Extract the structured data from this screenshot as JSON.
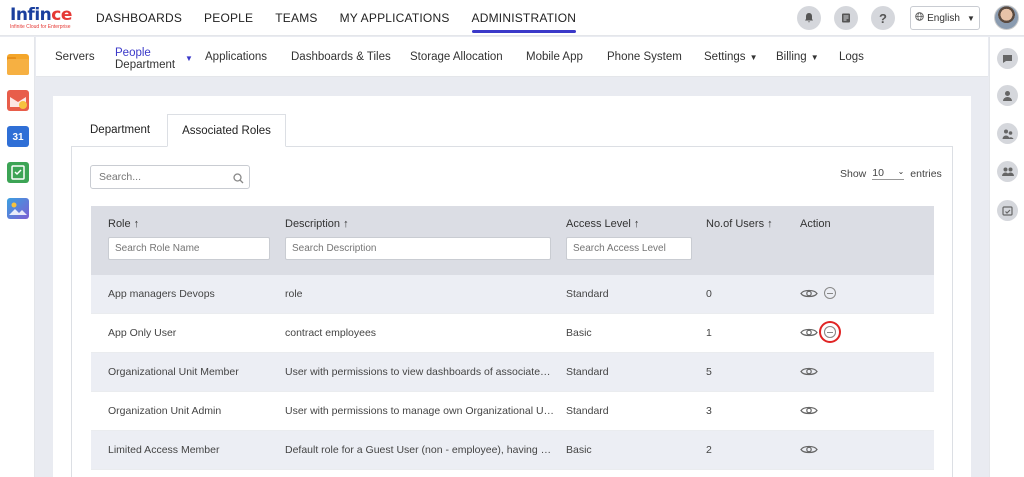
{
  "brand": {
    "name_part1": "Infin",
    "name_accent": "ce",
    "tagline": "Infinite Cloud for Enterprise"
  },
  "topnav": [
    {
      "label": "DASHBOARDS"
    },
    {
      "label": "PEOPLE"
    },
    {
      "label": "TEAMS"
    },
    {
      "label": "MY APPLICATIONS"
    },
    {
      "label": "ADMINISTRATION",
      "active": true
    }
  ],
  "header_actions": {
    "help_glyph": "?",
    "language": "English"
  },
  "left_apps": [
    "folder-icon",
    "mail-icon",
    "calendar-icon",
    "tasks-icon",
    "gallery-icon"
  ],
  "calendar_day": "31",
  "right_tools": [
    "chat-icon",
    "user-icon",
    "user-group-icon",
    "team-icon",
    "calendar-check-icon"
  ],
  "subnav": {
    "servers": "Servers",
    "people": "People",
    "people_sub": "Department",
    "applications": "Applications",
    "dashboards_tiles": "Dashboards & Tiles",
    "storage": "Storage Allocation",
    "mobile": "Mobile App",
    "phone": "Phone System",
    "settings": "Settings",
    "billing": "Billing",
    "logs": "Logs"
  },
  "tabs": {
    "department": "Department",
    "associated_roles": "Associated Roles"
  },
  "table_controls": {
    "search_placeholder": "Search...",
    "show": "Show",
    "entries_value": "10",
    "entries": "entries"
  },
  "columns": {
    "role": "Role ↑",
    "description": "Description ↑",
    "access_level": "Access Level ↑",
    "users": "No.of Users ↑",
    "action": "Action"
  },
  "filters": {
    "role": "Search Role Name",
    "description": "Search Description",
    "access": "Search Access Level"
  },
  "rows": [
    {
      "role": "App managers Devops",
      "description": "role",
      "access": "Standard",
      "users": "0"
    },
    {
      "role": "App Only User",
      "description": "contract employees",
      "access": "Basic",
      "users": "1"
    },
    {
      "role": "Organizational Unit Member",
      "description": "User with permissions to view dashboards of associated or...",
      "access": "Standard",
      "users": "5"
    },
    {
      "role": "Organization Unit Admin",
      "description": "User with permissions to manage own Organizational Unit(...",
      "access": "Standard",
      "users": "3"
    },
    {
      "role": "Limited Access Member",
      "description": "Default role for a Guest User (non - employee), having mini...",
      "access": "Basic",
      "users": "2"
    }
  ]
}
